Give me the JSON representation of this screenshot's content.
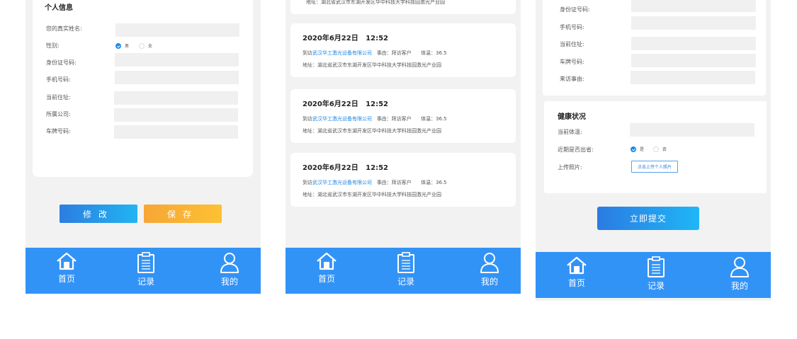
{
  "screen1": {
    "section_title": "个人信息",
    "labels": {
      "name": "您的真实姓名:",
      "gender": "性别:",
      "id": "身份证号码:",
      "phone": "手机号码:",
      "address": "当前住址:",
      "company": "所属公司:",
      "plate": "车牌号码:"
    },
    "gender_options": [
      "男",
      "女"
    ],
    "gender_selected": "男",
    "modify_label": "修改",
    "save_label": "保存"
  },
  "screen2": {
    "partial_address": "地址：湖北省武汉市东湖开发区华中科技大学科技园激光产业园",
    "records": [
      {
        "time": "2020年6月22日   12:52",
        "visit_prefix": "到访",
        "company": "武汉华工激光设备有限公司",
        "reason_label": "事由：拜访客户",
        "temp_label": "体温：36.5",
        "address": "地址：湖北省武汉市东湖开发区华中科技大学科技园激光产业园"
      },
      {
        "time": "2020年6月22日   12:52",
        "visit_prefix": "到访",
        "company": "武汉华工激光设备有限公司",
        "reason_label": "事由：拜访客户",
        "temp_label": "体温：36.5",
        "address": "地址：湖北省武汉市东湖开发区华中科技大学科技园激光产业园"
      },
      {
        "time": "2020年6月22日   12:52",
        "visit_prefix": "到访",
        "company": "武汉华工激光设备有限公司",
        "reason_label": "事由：拜访客户",
        "temp_label": "体温：36.5",
        "address": "地址：湖北省武汉市东湖开发区华中科技大学科技园激光产业园"
      }
    ]
  },
  "screen3": {
    "labels": {
      "id": "身份证号码:",
      "phone": "手机号码:",
      "address": "当前住址:",
      "plate": "车牌号码:",
      "reason": "来访事由:"
    },
    "health_title": "健康状况",
    "temp_label": "当前体温:",
    "out_province_label": "近期是否出省:",
    "out_province_options": [
      "是",
      "否"
    ],
    "out_province_selected": "是",
    "photo_label": "上传照片:",
    "upload_label": "点击上传个人照片",
    "submit_label": "立即提交"
  },
  "tabbar": {
    "home": "首页",
    "records": "记录",
    "mine": "我的"
  },
  "colors": {
    "primary": "#3293f7",
    "orange": "#f7a637",
    "link": "#1e88e5",
    "background": "#f2f2f2"
  },
  "icons": [
    "home-icon",
    "clipboard-icon",
    "user-icon",
    "check-icon"
  ]
}
